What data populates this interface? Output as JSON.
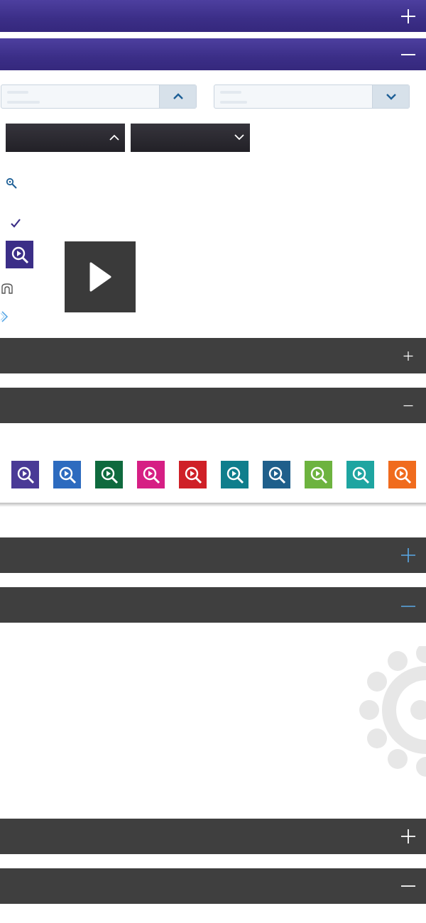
{
  "panels": [
    {
      "id": "panel-1",
      "style": "purple",
      "toggle": "plus-icon"
    },
    {
      "id": "panel-2",
      "style": "purple",
      "toggle": "minus-icon"
    },
    {
      "id": "panel-3",
      "style": "dark",
      "toggle": "plus-icon"
    },
    {
      "id": "panel-4",
      "style": "dark",
      "toggle": "minus-icon"
    },
    {
      "id": "panel-5",
      "style": "dark",
      "toggle": "plus-icon",
      "toggle_color": "#5aa8e6"
    },
    {
      "id": "panel-6",
      "style": "dark",
      "toggle": "minus-icon",
      "toggle_color": "#5aa8e6"
    },
    {
      "id": "panel-7",
      "style": "dark",
      "toggle": "plus-icon"
    },
    {
      "id": "panel-8",
      "style": "dark",
      "toggle": "minus-icon"
    }
  ],
  "light_selects": [
    {
      "value": "",
      "chevron": "chevron-up-icon"
    },
    {
      "value": "",
      "chevron": "chevron-down-icon"
    }
  ],
  "dark_selects": [
    {
      "value": "",
      "chevron": "chevron-up-icon"
    },
    {
      "value": "",
      "chevron": "chevron-down-icon"
    }
  ],
  "icons": [
    "search-key-icon",
    "check-icon",
    "zoom-play-icon",
    "play-icon",
    "arch-icon",
    "chevron-right-icon",
    "gear-icon"
  ],
  "swatches": [
    {
      "name": "purple",
      "color": "#4a3a96"
    },
    {
      "name": "blue",
      "color": "#2d6bbf"
    },
    {
      "name": "green",
      "color": "#0f6a3e"
    },
    {
      "name": "magenta",
      "color": "#d61f84"
    },
    {
      "name": "red",
      "color": "#cf2027"
    },
    {
      "name": "teal",
      "color": "#0f7e8c"
    },
    {
      "name": "navy",
      "color": "#1f5f8b"
    },
    {
      "name": "lime",
      "color": "#6db33f"
    },
    {
      "name": "aqua",
      "color": "#1ea5a1"
    },
    {
      "name": "orange",
      "color": "#f06b1d"
    }
  ],
  "colors": {
    "accent_purple": "#3b2e87",
    "dark_bar": "#3f3f3f",
    "link_blue": "#1d5f96",
    "check_purple": "#3b2e87"
  }
}
